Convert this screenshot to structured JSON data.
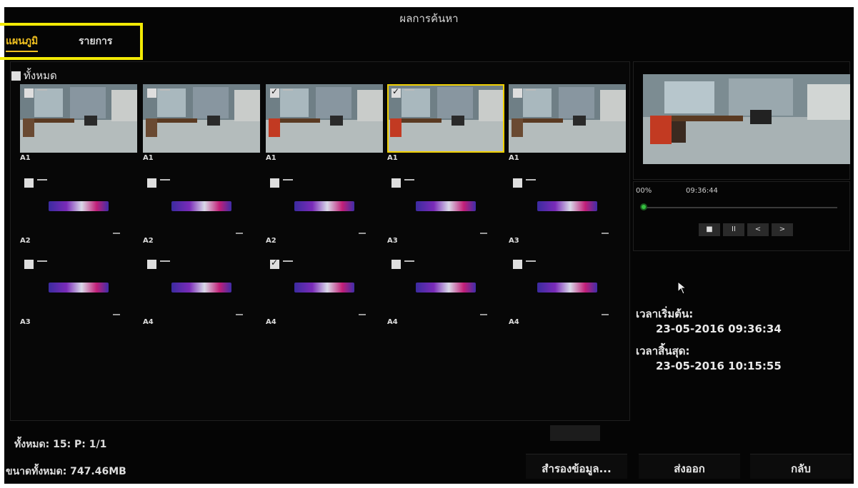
{
  "window": {
    "title": "ผลการค้นหา"
  },
  "tabs": [
    {
      "label": "แผนภูมิ",
      "active": true
    },
    {
      "label": "รายการ",
      "active": false
    }
  ],
  "select_all": {
    "label": "ทั้งหมด",
    "checked": false
  },
  "grid": [
    {
      "camera": "A1",
      "checked": false,
      "type": "thumbnail",
      "selected": false
    },
    {
      "camera": "A1",
      "checked": false,
      "type": "thumbnail",
      "selected": false
    },
    {
      "camera": "A1",
      "checked": true,
      "type": "thumbnail",
      "selected": false
    },
    {
      "camera": "A1",
      "checked": true,
      "type": "thumbnail",
      "selected": true
    },
    {
      "camera": "A1",
      "checked": false,
      "type": "thumbnail",
      "selected": false
    },
    {
      "camera": "A2",
      "checked": false,
      "type": "logo",
      "selected": false
    },
    {
      "camera": "A2",
      "checked": false,
      "type": "logo",
      "selected": false
    },
    {
      "camera": "A2",
      "checked": false,
      "type": "logo",
      "selected": false
    },
    {
      "camera": "A3",
      "checked": false,
      "type": "logo",
      "selected": false
    },
    {
      "camera": "A3",
      "checked": false,
      "type": "logo",
      "selected": false
    },
    {
      "camera": "A3",
      "checked": false,
      "type": "logo",
      "selected": false
    },
    {
      "camera": "A4",
      "checked": false,
      "type": "logo",
      "selected": false
    },
    {
      "camera": "A4",
      "checked": true,
      "type": "logo",
      "selected": false
    },
    {
      "camera": "A4",
      "checked": false,
      "type": "logo",
      "selected": false
    },
    {
      "camera": "A4",
      "checked": false,
      "type": "logo",
      "selected": false
    }
  ],
  "player": {
    "progress": "00%",
    "current_time": "09:36:44",
    "buttons": [
      "■",
      "II",
      "<",
      ">"
    ]
  },
  "info": {
    "start_label": "เวลาเริ่มต้น:",
    "start_value": "23-05-2016 09:36:34",
    "end_label": "เวลาสิ้นสุด:",
    "end_value": "23-05-2016 10:15:55"
  },
  "footer": {
    "total": "ทั้งหมด: 15: P: 1/1",
    "size": "ขนาดทั้งหมด: 747.46MB",
    "backup_label": "สำรองข้อมูล...",
    "export_label": "ส่งออก",
    "back_label": "กลับ"
  },
  "colors": {
    "accent": "#f0c020",
    "highlight_box": "#f2ea05",
    "background": "#050505"
  }
}
